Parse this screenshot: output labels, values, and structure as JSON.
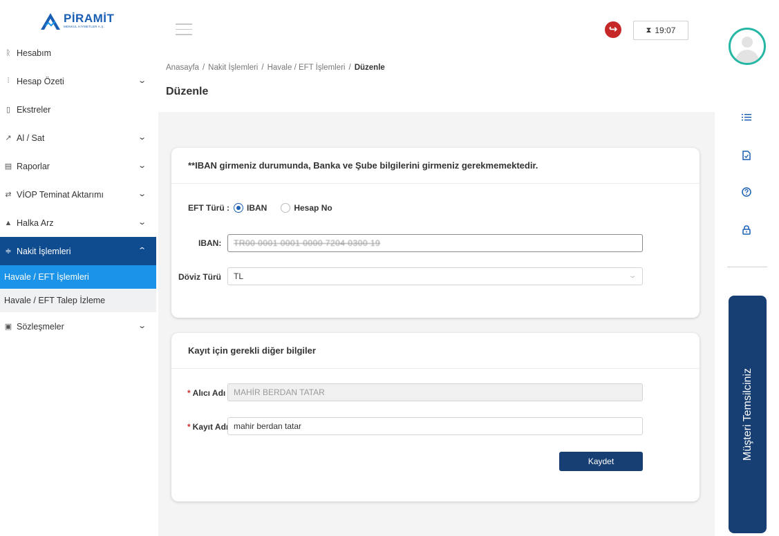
{
  "brand": {
    "name": "PİRAMİT",
    "subtitle": "MENKUL KIYMETLER A.Ş.",
    "color": "#1a5fb4"
  },
  "sidebar": {
    "items": [
      {
        "label": "Hesabım",
        "icon": "user-icon",
        "glyph": "ᚱ",
        "has_chevron": false
      },
      {
        "label": "Hesap Özeti",
        "icon": "summary-icon",
        "glyph": "⫶",
        "has_chevron": true
      },
      {
        "label": "Ekstreler",
        "icon": "document-icon",
        "glyph": "▯",
        "has_chevron": false
      },
      {
        "label": "Al / Sat",
        "icon": "trade-icon",
        "glyph": "↗",
        "has_chevron": true
      },
      {
        "label": "Raporlar",
        "icon": "report-icon",
        "glyph": "▤",
        "has_chevron": true
      },
      {
        "label": "VİOP Teminat Aktarımı",
        "icon": "transfer-icon",
        "glyph": "⇄",
        "has_chevron": true
      },
      {
        "label": "Halka Arz",
        "icon": "ipo-icon",
        "glyph": "▲",
        "has_chevron": true
      },
      {
        "label": "Nakit İşlemleri",
        "icon": "cash-icon",
        "glyph": "≑",
        "has_chevron": true,
        "active": true,
        "expanded": true
      },
      {
        "label": "Sözleşmeler",
        "icon": "contract-icon",
        "glyph": "▣",
        "has_chevron": true
      }
    ],
    "subitems": [
      {
        "label": "Havale / EFT İşlemleri",
        "active": true
      },
      {
        "label": "Havale / EFT Talep İzleme",
        "active": false
      }
    ]
  },
  "header": {
    "timer": "19:07",
    "timer_icon": "hourglass-icon",
    "logout_icon": "logout-icon"
  },
  "breadcrumb": [
    "Anasayfa",
    "Nakit İşlemleri",
    "Havale / EFT İşlemleri",
    "Düzenle"
  ],
  "page_title": "Düzenle",
  "card1": {
    "notice": "**IBAN girmeniz durumunda, Banka ve Şube bilgilerini girmeniz gerekmemektedir.",
    "eft_type_label": "EFT Türü :",
    "eft_options": [
      {
        "label": "IBAN",
        "selected": true
      },
      {
        "label": "Hesap No",
        "selected": false
      }
    ],
    "iban_label": "IBAN:",
    "iban_value": "TR00 0001 0001 0000 7204 0300 19",
    "currency_label": "Döviz Türü",
    "currency_value": "TL"
  },
  "card2": {
    "title": "Kayıt için gerekli diğer bilgiler",
    "recipient_label": "Alıcı Adı",
    "recipient_value": "MAHİR BERDAN TATAR",
    "record_label": "Kayıt Adı",
    "record_value": "mahir berdan tatar",
    "save_label": "Kaydet",
    "required_mark": "*"
  },
  "rail": {
    "icons": [
      "list-icon",
      "file-icon",
      "help-icon",
      "lock-icon"
    ],
    "rep_tab": "Müşteri Temsilciniz",
    "avatar_ring_color": "#25b7a4"
  },
  "colors": {
    "primary_dark": "#173f73",
    "active_menu": "#0f4c8f",
    "active_sub": "#1a93e8",
    "required": "#d32f2f"
  }
}
